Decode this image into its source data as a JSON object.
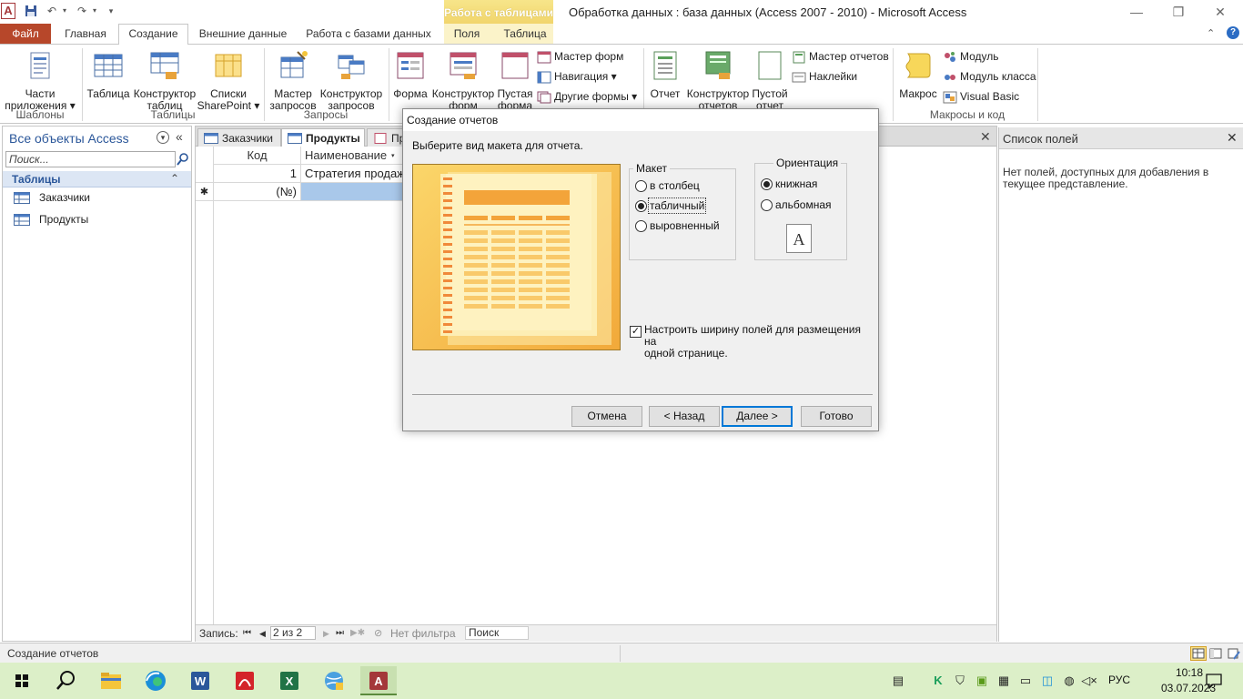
{
  "window": {
    "title": "Обработка данных : база данных (Access 2007 - 2010) -  Microsoft Access",
    "context_header": "Работа с таблицами",
    "app_letter": "A",
    "minimize": "—",
    "restore": "❐",
    "close": "✕"
  },
  "tabs": {
    "file": "Файл",
    "home": "Главная",
    "create": "Создание",
    "external": "Внешние данные",
    "database": "Работа с базами данных",
    "fields": "Поля",
    "table": "Таблица"
  },
  "ribbon": {
    "templates": {
      "label": "Шаблоны",
      "parts_line1": "Части",
      "parts_line2": "приложения ▾"
    },
    "tables": {
      "label": "Таблицы",
      "table": "Таблица",
      "designer_line1": "Конструктор",
      "designer_line2": "таблиц",
      "sharepoint_line1": "Списки",
      "sharepoint_line2": "SharePoint ▾"
    },
    "queries": {
      "label": "Запросы",
      "wizard_line1": "Мастер",
      "wizard_line2": "запросов",
      "designer_line1": "Конструктор",
      "designer_line2": "запросов"
    },
    "forms": {
      "form": "Форма",
      "designer_line1": "Конструктор",
      "designer_line2": "форм",
      "blank_line1": "Пустая",
      "blank_line2": "форма",
      "wizard": "Мастер форм",
      "navigation": "Навигация ▾",
      "other": "Другие формы ▾"
    },
    "reports": {
      "report": "Отчет",
      "designer_line1": "Конструктор",
      "designer_line2": "отчетов",
      "blank_line1": "Пустой",
      "blank_line2": "отчет",
      "wizard": "Мастер отчетов",
      "labels": "Наклейки"
    },
    "macros": {
      "label": "Макросы и код",
      "macro": "Макрос",
      "module": "Модуль",
      "class_module": "Модуль класса",
      "vb": "Visual Basic"
    }
  },
  "nav": {
    "title": "Все объекты Access",
    "search_placeholder": "Поиск...",
    "group": "Таблицы",
    "items": [
      {
        "label": "Заказчики"
      },
      {
        "label": "Продукты"
      }
    ]
  },
  "doc": {
    "tabs": [
      {
        "label": "Заказчики"
      },
      {
        "label": "Продукты"
      },
      {
        "label": "Пр"
      }
    ],
    "columns": [
      "Код",
      "Наименование"
    ],
    "rows": [
      {
        "id": "1",
        "name": "Стратегия продаж"
      }
    ],
    "new_row_id": "(№)",
    "new_row_marker": "✱",
    "record_label": "Запись:",
    "record_pos": "2 из 2",
    "filter": "Нет фильтра",
    "search": "Поиск"
  },
  "fieldlist": {
    "title": "Список полей",
    "message": "Нет полей, доступных для добавления в текущее представление."
  },
  "status": {
    "text": "Создание отчетов"
  },
  "dialog": {
    "title": "Создание отчетов",
    "prompt": "Выберите вид макета для отчета.",
    "layout_legend": "Макет",
    "layout_options": [
      "в столбец",
      "табличный",
      "выровненный"
    ],
    "layout_selected": "табличный",
    "orientation_legend": "Ориентация",
    "orientation_options": [
      "книжная",
      "альбомная"
    ],
    "orientation_selected": "книжная",
    "orientation_icon_letter": "A",
    "fit_checkbox_line1": "Настроить ширину полей для размещения на",
    "fit_checkbox_line2": "одной странице.",
    "fit_checked": true,
    "buttons": {
      "cancel": "Отмена",
      "back": "< Назад",
      "next": "Далее >",
      "finish": "Готово"
    }
  },
  "taskbar": {
    "time": "10:18",
    "date": "03.07.2023",
    "lang": "РУС"
  },
  "colors": {
    "file_tab": "#b7472a",
    "access_accent": "#a4373a",
    "context_yellow": "#f1d56c",
    "taskbar": "#dcefc8",
    "dialog_focus": "#0078d7"
  }
}
